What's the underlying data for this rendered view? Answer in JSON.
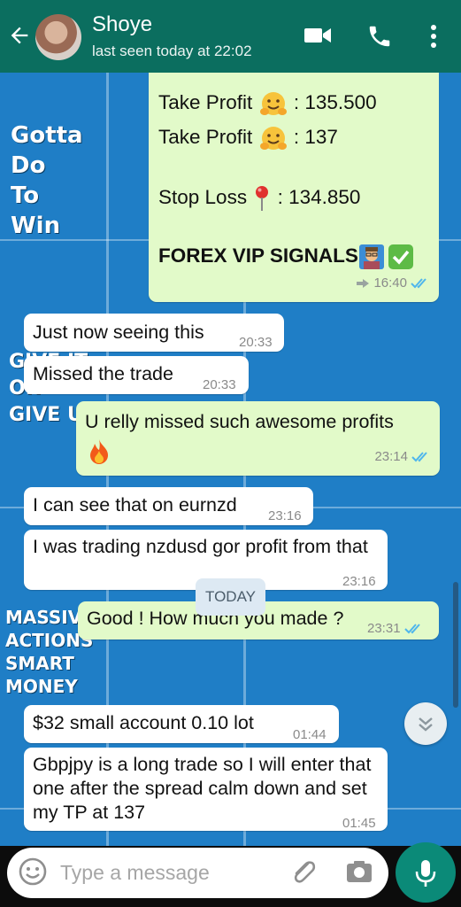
{
  "header": {
    "contact_name": "Shoye",
    "status": "last seen today at 22:02",
    "icons": [
      "back-arrow-icon",
      "avatar",
      "video-call-icon",
      "voice-call-icon",
      "more-menu-icon"
    ]
  },
  "background": {
    "gotta": [
      "Gotta",
      "Do",
      "To",
      "Win"
    ],
    "give": [
      "GIVE IT",
      "OR",
      "GIVE UP"
    ],
    "massive": [
      "MASSIVE",
      "ACTIONS",
      "SMART",
      "MONEY"
    ]
  },
  "signal_message": {
    "line1": "Take Profit",
    "line1_value": ": 135.500",
    "line2": "Take Profit",
    "line2_value": ": 137",
    "line3": "Stop Loss",
    "line3_value": ": 134.850",
    "title": "FOREX VIP SIGNALS",
    "time": "16:40"
  },
  "messages": [
    {
      "dir": "in",
      "text": "Just now seeing this",
      "time": "20:33"
    },
    {
      "dir": "in",
      "text": "Missed the trade",
      "time": "20:33"
    },
    {
      "dir": "out",
      "text": "U relly missed such awesome profits",
      "time": "23:14"
    },
    {
      "dir": "in",
      "text": "I can see that on eurnzd",
      "time": "23:16"
    },
    {
      "dir": "in",
      "text": "I was trading nzdusd gor profit from that",
      "time": "23:16"
    },
    {
      "dir": "out",
      "text": "Good ! How much you made ?",
      "time": "23:31"
    },
    {
      "dir": "in",
      "text": "$32 small account 0.10 lot",
      "time": "01:44"
    },
    {
      "dir": "in",
      "text": "Gbpjpy is a long trade so I will enter that one after the spread calm down and set my TP at 137",
      "time": "01:45"
    }
  ],
  "date_divider": "TODAY",
  "input": {
    "placeholder": "Type a message"
  },
  "colors": {
    "header": "#0b6e5f",
    "outgoing_bubble": "#e2fac9",
    "incoming_bubble": "#ffffff",
    "read_ticks": "#4fb6ec",
    "mic_button": "#0b8a78"
  }
}
